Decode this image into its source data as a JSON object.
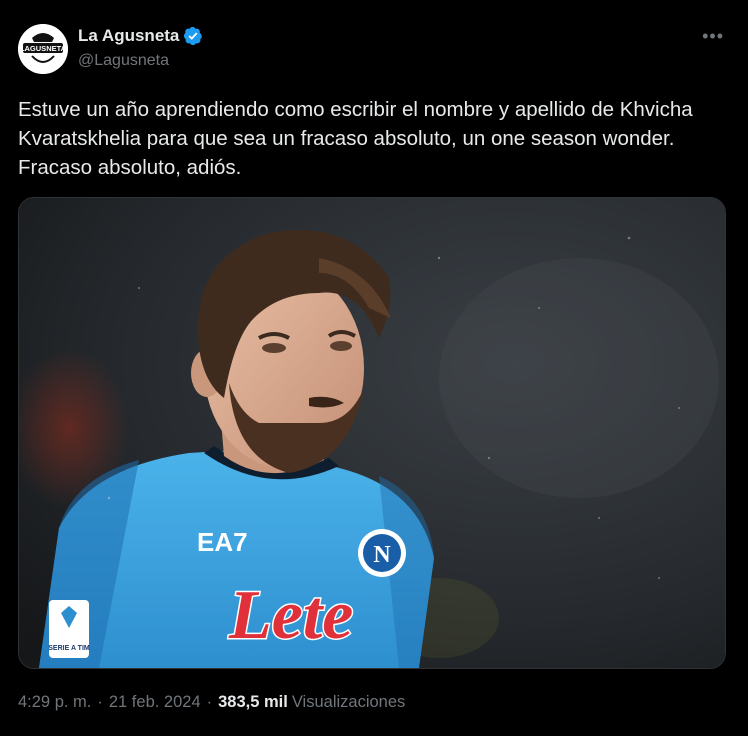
{
  "author": {
    "display_name": "La Agusneta",
    "handle": "@Lagusneta",
    "avatar_text": "LAGUSNETA",
    "verified": true
  },
  "more_icon": "•••",
  "tweet": {
    "text": "Estuve un año aprendiendo como escribir el nombre y apellido de Khvicha Kvaratskhelia para que sea un fracaso absoluto, un one season wonder. Fracaso absoluto, adiós."
  },
  "media": {
    "jersey_sponsor": "Lete",
    "jersey_brand": "EA7",
    "crest_letter": "N",
    "patch_text": "SERIE A TIM"
  },
  "meta": {
    "time": "4:29 p. m.",
    "separator": "·",
    "date": "21 feb. 2024",
    "views_count": "383,5 mil",
    "views_label": "Visualizaciones"
  },
  "colors": {
    "background": "#000000",
    "text_primary": "#e7e9ea",
    "text_secondary": "#71767b",
    "verified_blue": "#1d9bf0",
    "jersey_blue": "#39a7e0",
    "sponsor_red": "#e0303a"
  }
}
